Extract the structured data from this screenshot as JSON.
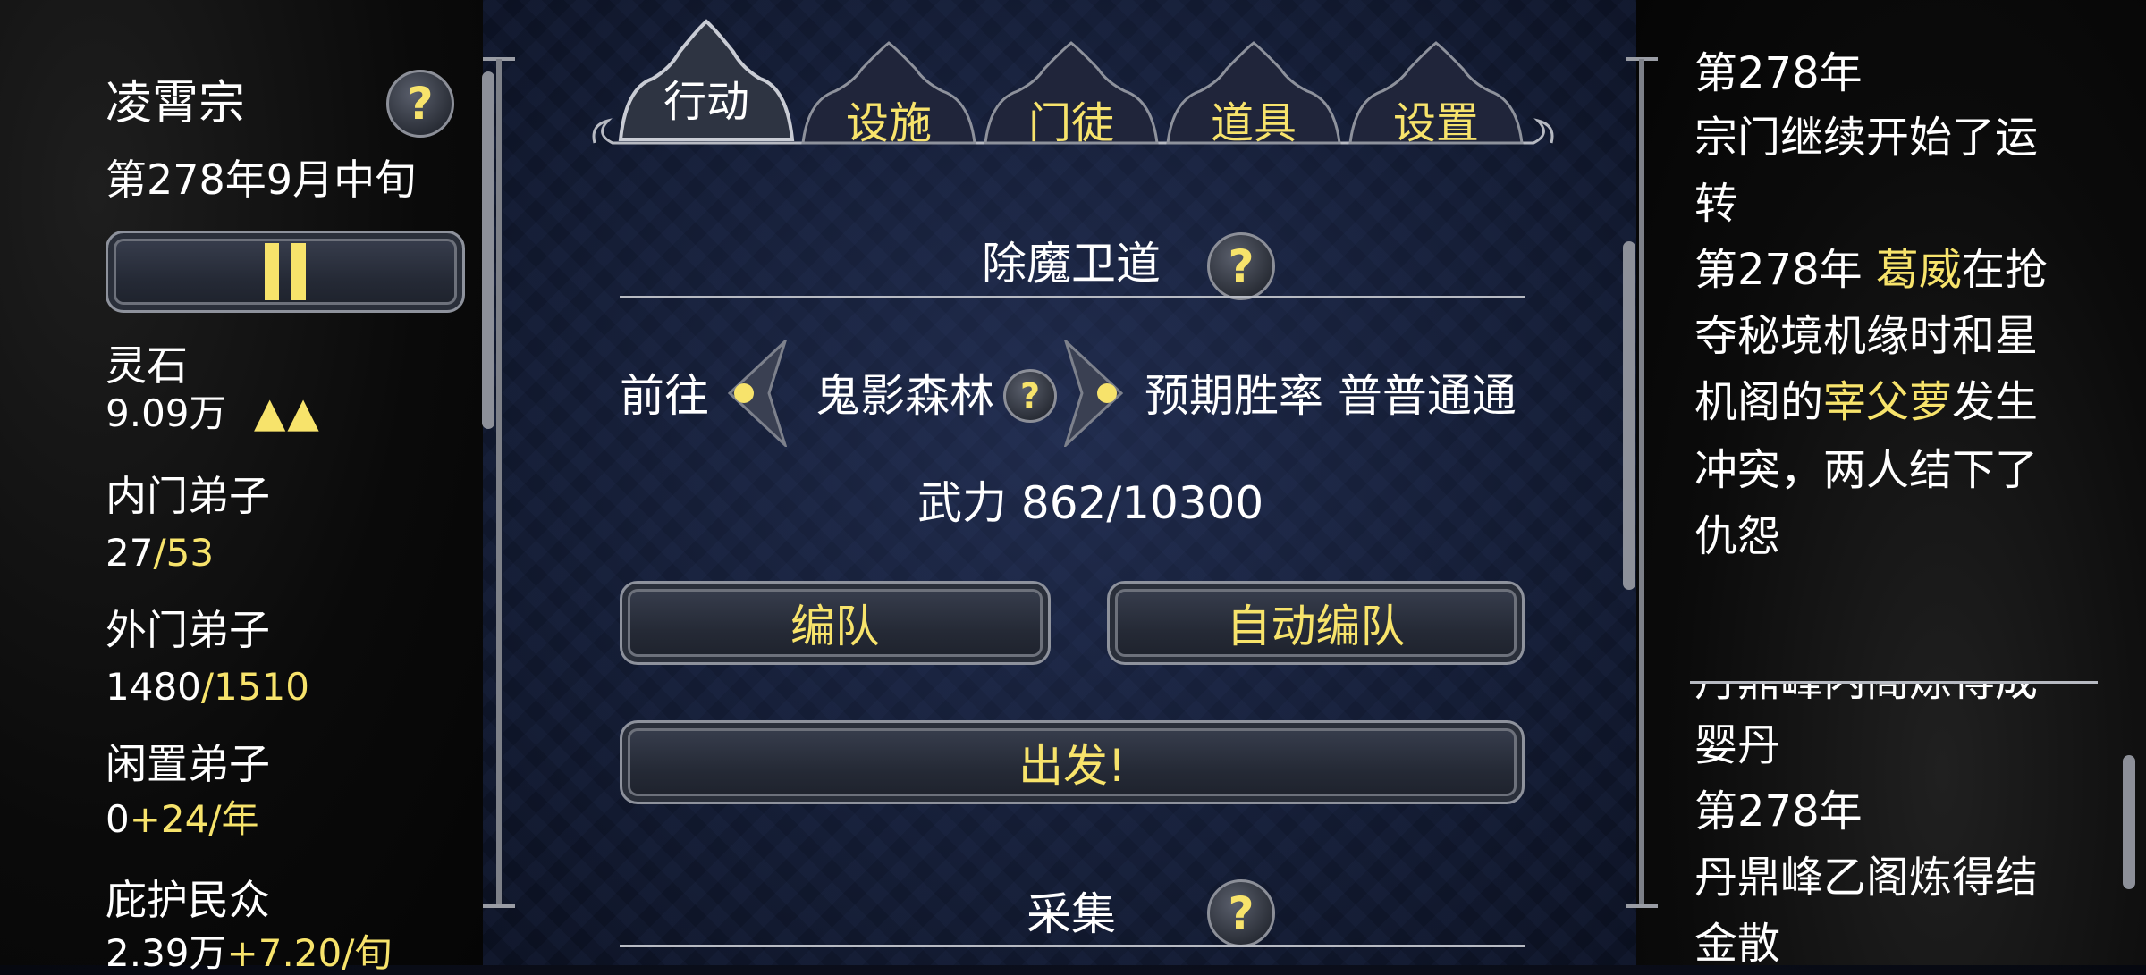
{
  "sidebar": {
    "sect_name": "凌霄宗",
    "date": "第278年9月中旬",
    "stats": [
      {
        "label": "灵石",
        "value": "9.09万",
        "arrows": "▲▲"
      },
      {
        "label": "内门弟子",
        "value": "27",
        "value_extra": "/53"
      },
      {
        "label": "外门弟子",
        "value": "1480",
        "value_extra": "/1510"
      },
      {
        "label": "闲置弟子",
        "value": "0",
        "value_extra": "+24/年"
      },
      {
        "label": "庇护民众",
        "value": "2.39万",
        "value_extra": "+7.20/旬"
      }
    ]
  },
  "tabs": [
    {
      "label": "行动",
      "active": true
    },
    {
      "label": "设施",
      "active": false
    },
    {
      "label": "门徒",
      "active": false
    },
    {
      "label": "道具",
      "active": false
    },
    {
      "label": "设置",
      "active": false
    }
  ],
  "mission": {
    "title": "除魔卫道",
    "goto_label": "前往",
    "location": "鬼影森林",
    "win_rate_label": "预期胜率",
    "win_rate_value": "普普通通",
    "power_label": "武力",
    "power_value": "862/10300",
    "team_button": "编队",
    "auto_team_button": "自动编队",
    "depart_button": "出发!"
  },
  "gather": {
    "title": "采集"
  },
  "log": {
    "lines": [
      {
        "parts": [
          {
            "t": "第278年"
          }
        ]
      },
      {
        "parts": [
          {
            "t": "宗门继续开始了运"
          }
        ]
      },
      {
        "parts": [
          {
            "t": "转"
          }
        ]
      },
      {
        "parts": [
          {
            "t": "第278年 "
          },
          {
            "t": "葛威",
            "hl": true
          },
          {
            "t": "在抢"
          }
        ]
      },
      {
        "parts": [
          {
            "t": "夺秘境机缘时和星"
          }
        ]
      },
      {
        "parts": [
          {
            "t": "机阁的"
          },
          {
            "t": "宰父萝",
            "hl": true
          },
          {
            "t": "发生"
          }
        ]
      },
      {
        "parts": [
          {
            "t": "冲突，两人结下了"
          }
        ]
      },
      {
        "parts": [
          {
            "t": "仇怨"
          }
        ]
      }
    ],
    "lower_lines": [
      {
        "parts": [
          {
            "t": "丹鼎峰内阁炼得成"
          }
        ]
      },
      {
        "parts": [
          {
            "t": "婴丹"
          }
        ]
      },
      {
        "parts": [
          {
            "t": "第278年"
          }
        ]
      },
      {
        "parts": [
          {
            "t": "丹鼎峰乙阁炼得结"
          }
        ]
      },
      {
        "parts": [
          {
            "t": "金散"
          }
        ]
      }
    ]
  },
  "colors": {
    "highlight": "#f7e36b",
    "text": "#ffffff",
    "frame": "#8e929c"
  },
  "icons": {
    "pause": "pause-icon",
    "help": "help-icon",
    "arrow_left": "arrow-left-icon",
    "arrow_right": "arrow-right-icon"
  }
}
